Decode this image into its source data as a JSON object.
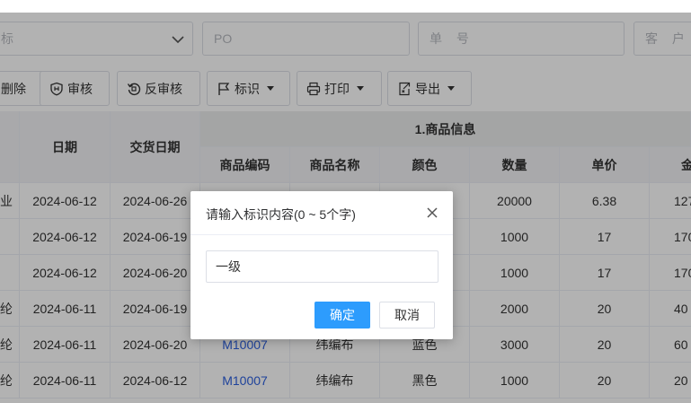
{
  "filters": {
    "first_partial": "标",
    "po_placeholder": "PO",
    "order_no_placeholder": "单 号",
    "customer_partial": "客 户"
  },
  "toolbar": {
    "delete_partial": "删除",
    "approve": "审核",
    "unapprove": "反审核",
    "mark": "标识",
    "print": "打印",
    "export": "导出"
  },
  "table": {
    "group_header": "1.商品信息",
    "headers": {
      "date": "日期",
      "delivery_date": "交货日期",
      "code": "商品编码",
      "name": "商品名称",
      "color": "颜色",
      "qty": "数量",
      "price": "单价",
      "amount_partial": "金"
    },
    "rows": [
      {
        "c0": "业",
        "date": "2024-06-12",
        "delivery": "2024-06-26",
        "code": "",
        "name": "",
        "color": "",
        "qty": "20000",
        "price": "6.38",
        "amount": "127"
      },
      {
        "c0": "",
        "date": "2024-06-12",
        "delivery": "2024-06-19",
        "code": "",
        "name": "",
        "color": "",
        "qty": "1000",
        "price": "17",
        "amount": "170"
      },
      {
        "c0": "",
        "date": "2024-06-12",
        "delivery": "2024-06-20",
        "code": "",
        "name": "",
        "color": "",
        "qty": "1000",
        "price": "17",
        "amount": "170"
      },
      {
        "c0": "纶",
        "date": "2024-06-11",
        "delivery": "2024-06-19",
        "code": "",
        "name": "",
        "color": "",
        "qty": "2000",
        "price": "20",
        "amount": "40"
      },
      {
        "c0": "纶",
        "date": "2024-06-11",
        "delivery": "2024-06-20",
        "code": "M10007",
        "name": "纬编布",
        "color": "蓝色",
        "qty": "3000",
        "price": "20",
        "amount": "60"
      },
      {
        "c0": "纶",
        "date": "2024-06-11",
        "delivery": "2024-06-12",
        "code": "M10007",
        "name": "纬编布",
        "color": "黑色",
        "qty": "1000",
        "price": "20",
        "amount": "20"
      }
    ]
  },
  "dialog": {
    "title": "请输入标识内容(0 ~ 5个字)",
    "input_value": "一级",
    "ok": "确定",
    "cancel": "取消"
  }
}
